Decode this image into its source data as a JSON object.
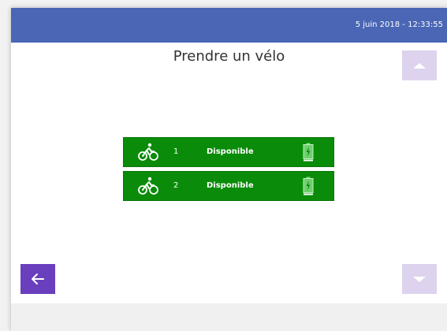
{
  "header": {
    "datetime": "5 juin 2018 - 12:33:55"
  },
  "page": {
    "title": "Prendre un vélo"
  },
  "bikes": [
    {
      "number": "1",
      "status": "Disponible"
    },
    {
      "number": "2",
      "status": "Disponible"
    }
  ],
  "colors": {
    "header_bg": "#4a66b5",
    "bike_row_bg": "#0a8c0a",
    "back_button_bg": "#6a3fbd",
    "scroll_button_bg": "#ddd3ee"
  },
  "icons": {
    "back": "arrow-left-icon",
    "scroll_up": "triangle-up-icon",
    "scroll_down": "triangle-down-icon",
    "bike": "bicycle-rider-icon",
    "battery": "battery-charging-icon"
  }
}
